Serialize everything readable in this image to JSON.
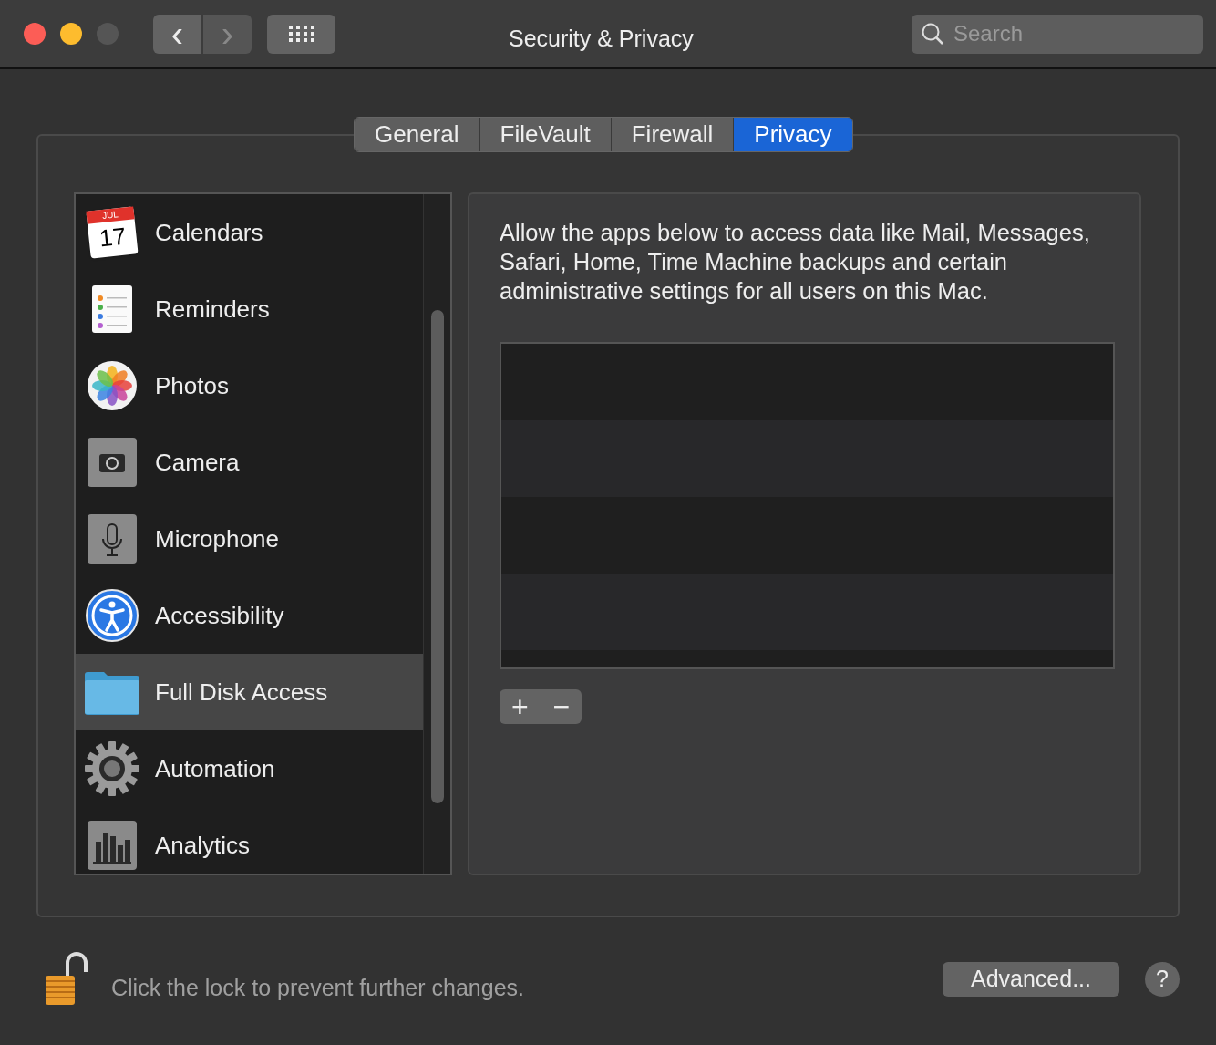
{
  "window": {
    "title": "Security & Privacy"
  },
  "toolbar": {
    "back": "‹",
    "forward": "›"
  },
  "search": {
    "placeholder": "Search"
  },
  "tabs": [
    {
      "label": "General",
      "selected": false
    },
    {
      "label": "FileVault",
      "selected": false
    },
    {
      "label": "Firewall",
      "selected": false
    },
    {
      "label": "Privacy",
      "selected": true
    }
  ],
  "sidebar": {
    "items": [
      {
        "kind": "calendar",
        "label": "Calendars",
        "selected": false,
        "icon_month": "JUL",
        "icon_day": "17"
      },
      {
        "kind": "reminders",
        "label": "Reminders",
        "selected": false
      },
      {
        "kind": "photos",
        "label": "Photos",
        "selected": false
      },
      {
        "kind": "camera",
        "label": "Camera",
        "selected": false
      },
      {
        "kind": "microphone",
        "label": "Microphone",
        "selected": false
      },
      {
        "kind": "accessibility",
        "label": "Accessibility",
        "selected": false
      },
      {
        "kind": "folder",
        "label": "Full Disk Access",
        "selected": true
      },
      {
        "kind": "gear",
        "label": "Automation",
        "selected": false
      },
      {
        "kind": "analytics",
        "label": "Analytics",
        "selected": false
      }
    ]
  },
  "detail": {
    "description": "Allow the apps below to access data like Mail, Messages, Safari, Home, Time Machine backups and certain administrative settings for all users on this Mac.",
    "add": "+",
    "remove": "−"
  },
  "footer": {
    "lock_text": "Click the lock to prevent further changes.",
    "lock_open": true,
    "advanced": "Advanced...",
    "help": "?"
  }
}
